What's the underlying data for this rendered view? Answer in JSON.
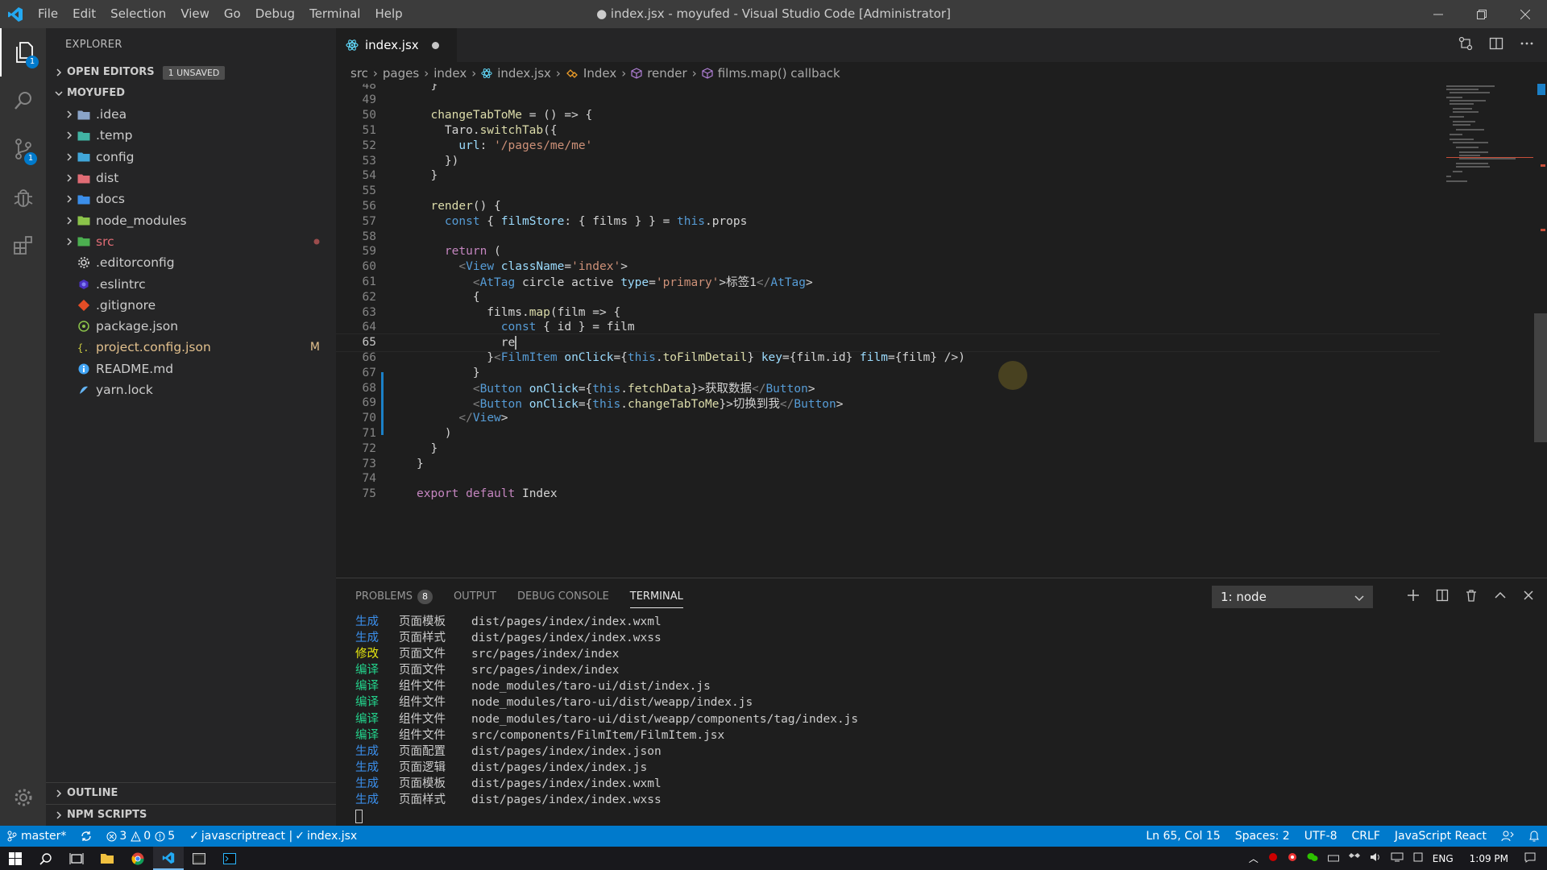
{
  "window": {
    "title": "● index.jsx - moyufed - Visual Studio Code [Administrator]",
    "menu": [
      "File",
      "Edit",
      "Selection",
      "View",
      "Go",
      "Debug",
      "Terminal",
      "Help"
    ]
  },
  "activity_bar": {
    "items": [
      "explorer-icon",
      "search-icon",
      "source-control-icon",
      "debug-icon",
      "extensions-icon"
    ],
    "explorer_badge": "1",
    "scm_badge": "1"
  },
  "sidebar": {
    "title": "EXPLORER",
    "open_editors": {
      "label": "OPEN EDITORS",
      "badge": "1 UNSAVED"
    },
    "workspace": "MOYUFED",
    "tree": [
      {
        "name": ".idea",
        "type": "folder",
        "color": "#8aa4c8"
      },
      {
        "name": ".temp",
        "type": "folder",
        "color": "#41b3a3"
      },
      {
        "name": "config",
        "type": "folder",
        "color": "#41a6d9"
      },
      {
        "name": "dist",
        "type": "folder",
        "color": "#e06c75"
      },
      {
        "name": "docs",
        "type": "folder",
        "color": "#3b8eea"
      },
      {
        "name": "node_modules",
        "type": "folder",
        "color": "#8bc34a"
      },
      {
        "name": "src",
        "type": "folder",
        "color": "#4caf50",
        "modified": true
      },
      {
        "name": ".editorconfig",
        "type": "file",
        "icon": "gear-file-icon"
      },
      {
        "name": ".eslintrc",
        "type": "file",
        "icon": "eslint-file-icon"
      },
      {
        "name": ".gitignore",
        "type": "file",
        "icon": "git-file-icon"
      },
      {
        "name": "package.json",
        "type": "file",
        "icon": "npm-file-icon"
      },
      {
        "name": "project.config.json",
        "type": "file",
        "icon": "json-file-icon",
        "badge": "M"
      },
      {
        "name": "README.md",
        "type": "file",
        "icon": "info-file-icon"
      },
      {
        "name": "yarn.lock",
        "type": "file",
        "icon": "yarn-file-icon"
      }
    ],
    "outline": "OUTLINE",
    "npm_scripts": "NPM SCRIPTS"
  },
  "editor": {
    "tab": "index.jsx",
    "breadcrumb": [
      "src",
      "pages",
      "index",
      "index.jsx",
      "Index",
      "render",
      "films.map() callback"
    ],
    "lines": [
      {
        "n": "48",
        "text": "  }"
      },
      {
        "n": "49",
        "text": ""
      },
      {
        "n": "50",
        "text": "  changeTabToMe = () => {"
      },
      {
        "n": "51",
        "text": "    Taro.switchTab({"
      },
      {
        "n": "52",
        "text": "      url: '/pages/me/me'"
      },
      {
        "n": "53",
        "text": "    })"
      },
      {
        "n": "54",
        "text": "  }"
      },
      {
        "n": "55",
        "text": ""
      },
      {
        "n": "56",
        "text": "  render() {"
      },
      {
        "n": "57",
        "text": "    const { filmStore: { films } } = this.props"
      },
      {
        "n": "58",
        "text": ""
      },
      {
        "n": "59",
        "text": "    return ("
      },
      {
        "n": "60",
        "text": "      <View className='index'>"
      },
      {
        "n": "61",
        "text": "        <AtTag circle active type='primary'>标签1</AtTag>"
      },
      {
        "n": "62",
        "text": "        {"
      },
      {
        "n": "63",
        "text": "          films.map(film => {"
      },
      {
        "n": "64",
        "text": "            const { id } = film"
      },
      {
        "n": "65",
        "text": "            re"
      },
      {
        "n": "66",
        "text": "          }<FilmItem onClick={this.toFilmDetail} key={film.id} film={film} />)"
      },
      {
        "n": "67",
        "text": "        }"
      },
      {
        "n": "68",
        "text": "        <Button onClick={this.fetchData}>获取数据</Button>"
      },
      {
        "n": "69",
        "text": "        <Button onClick={this.changeTabToMe}>切换到我</Button>"
      },
      {
        "n": "70",
        "text": "      </View>"
      },
      {
        "n": "71",
        "text": "    )"
      },
      {
        "n": "72",
        "text": "  }"
      },
      {
        "n": "73",
        "text": "}"
      },
      {
        "n": "74",
        "text": ""
      },
      {
        "n": "75",
        "text": "export default Index"
      }
    ],
    "current_line": "65"
  },
  "panel": {
    "tabs": [
      {
        "label": "PROBLEMS",
        "badge": "8"
      },
      {
        "label": "OUTPUT"
      },
      {
        "label": "DEBUG CONSOLE"
      },
      {
        "label": "TERMINAL",
        "active": true
      }
    ],
    "terminal_select": "1: node",
    "terminal_lines": [
      {
        "tag": "生成",
        "kind": "gen",
        "cat": "页面模板",
        "path": "dist/pages/index/index.wxml"
      },
      {
        "tag": "生成",
        "kind": "gen",
        "cat": "页面样式",
        "path": "dist/pages/index/index.wxss"
      },
      {
        "tag": "修改",
        "kind": "mod",
        "cat": "页面文件",
        "path": "src/pages/index/index"
      },
      {
        "tag": "编译",
        "kind": "cmp",
        "cat": "页面文件",
        "path": "src/pages/index/index"
      },
      {
        "tag": "编译",
        "kind": "cmp",
        "cat": "组件文件",
        "path": "node_modules/taro-ui/dist/index.js"
      },
      {
        "tag": "编译",
        "kind": "cmp",
        "cat": "组件文件",
        "path": "node_modules/taro-ui/dist/weapp/index.js"
      },
      {
        "tag": "编译",
        "kind": "cmp",
        "cat": "组件文件",
        "path": "node_modules/taro-ui/dist/weapp/components/tag/index.js"
      },
      {
        "tag": "编译",
        "kind": "cmp",
        "cat": "组件文件",
        "path": "src/components/FilmItem/FilmItem.jsx"
      },
      {
        "tag": "生成",
        "kind": "gen",
        "cat": "页面配置",
        "path": "dist/pages/index/index.json"
      },
      {
        "tag": "生成",
        "kind": "gen",
        "cat": "页面逻辑",
        "path": "dist/pages/index/index.js"
      },
      {
        "tag": "生成",
        "kind": "gen",
        "cat": "页面模板",
        "path": "dist/pages/index/index.wxml"
      },
      {
        "tag": "生成",
        "kind": "gen",
        "cat": "页面样式",
        "path": "dist/pages/index/index.wxss"
      }
    ]
  },
  "statusbar": {
    "branch": "master*",
    "errors": "3",
    "warnings": "0",
    "infos": "5",
    "linter": "javascriptreact | ",
    "linter_file": "index.jsx",
    "position": "Ln 65, Col 15",
    "spaces": "Spaces: 2",
    "encoding": "UTF-8",
    "eol": "CRLF",
    "language": "JavaScript React"
  },
  "taskbar": {
    "lang": "ENG",
    "time": "1:09 PM"
  },
  "colors": {
    "accent": "#007acc",
    "modified": "#e2c08d",
    "error_dot": "#c74e39"
  }
}
